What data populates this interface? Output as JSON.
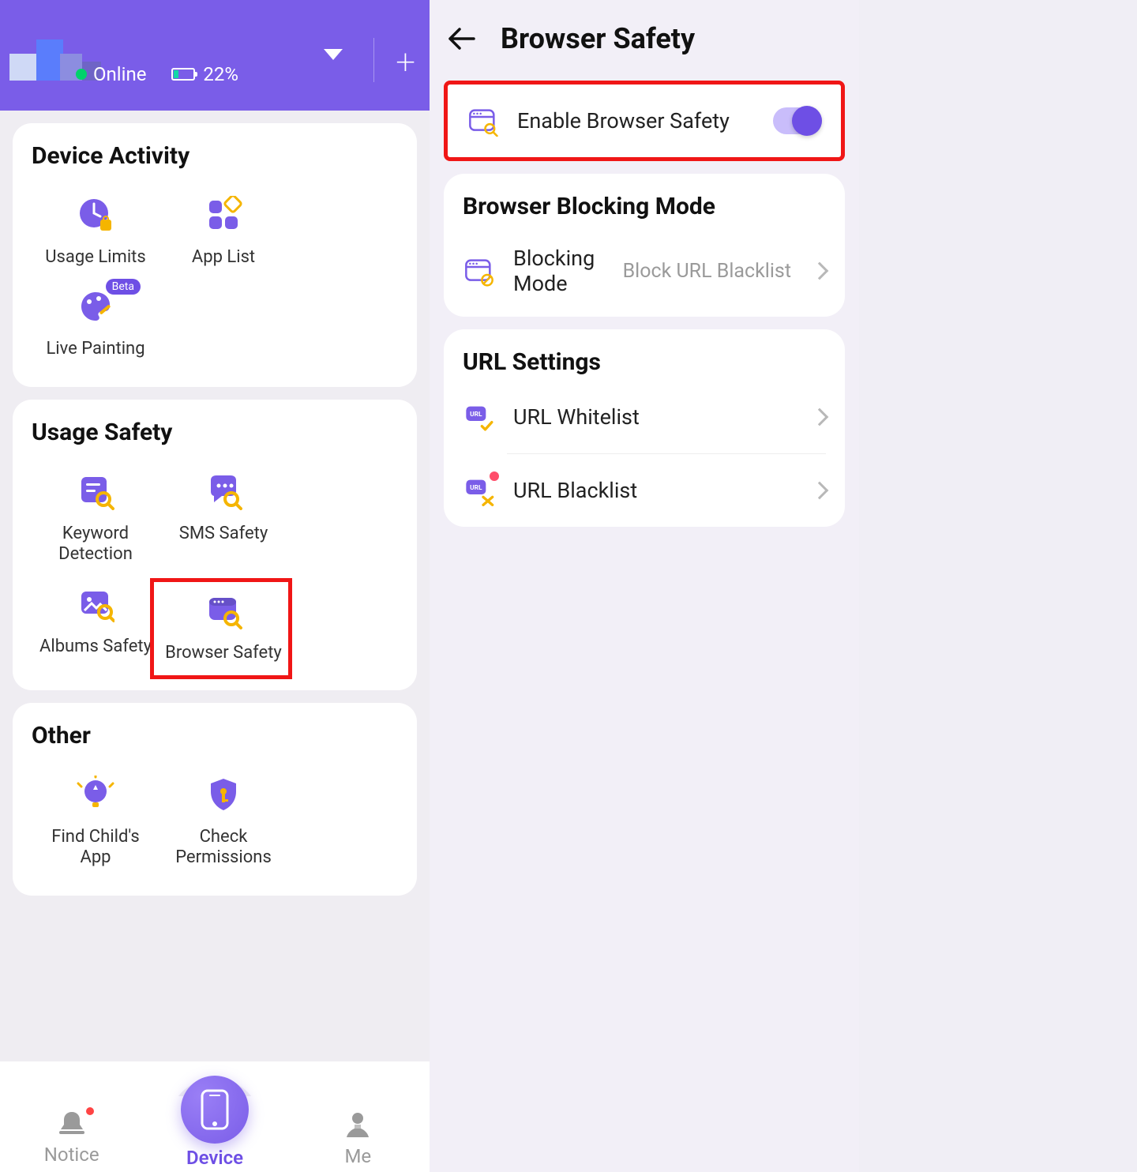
{
  "left": {
    "status": {
      "online_label": "Online",
      "battery_pct": "22%"
    },
    "activity": {
      "title": "Device Activity",
      "items": [
        {
          "label": "Usage Limits"
        },
        {
          "label": "App List"
        },
        {
          "label": "Live Painting",
          "badge": "Beta"
        }
      ]
    },
    "safety": {
      "title": "Usage Safety",
      "items": [
        {
          "label": "Keyword Detection"
        },
        {
          "label": "SMS Safety"
        },
        {
          "label": "Albums Safety"
        },
        {
          "label": "Browser Safety"
        }
      ]
    },
    "other": {
      "title": "Other",
      "items": [
        {
          "label": "Find Child's App"
        },
        {
          "label": "Check Permissions"
        }
      ]
    },
    "nav": {
      "notice": "Notice",
      "device": "Device",
      "me": "Me"
    }
  },
  "right": {
    "title": "Browser Safety",
    "enable_row": {
      "label": "Enable Browser Safety",
      "enabled": true
    },
    "blocking": {
      "title": "Browser Blocking Mode",
      "mode_label": "Blocking Mode",
      "mode_value": "Block URL Blacklist"
    },
    "url": {
      "title": "URL Settings",
      "whitelist_label": "URL Whitelist",
      "blacklist_label": "URL Blacklist"
    }
  },
  "colors": {
    "accent": "#6e4fe5",
    "gold": "#f5b500",
    "highlight": "#f01616"
  }
}
